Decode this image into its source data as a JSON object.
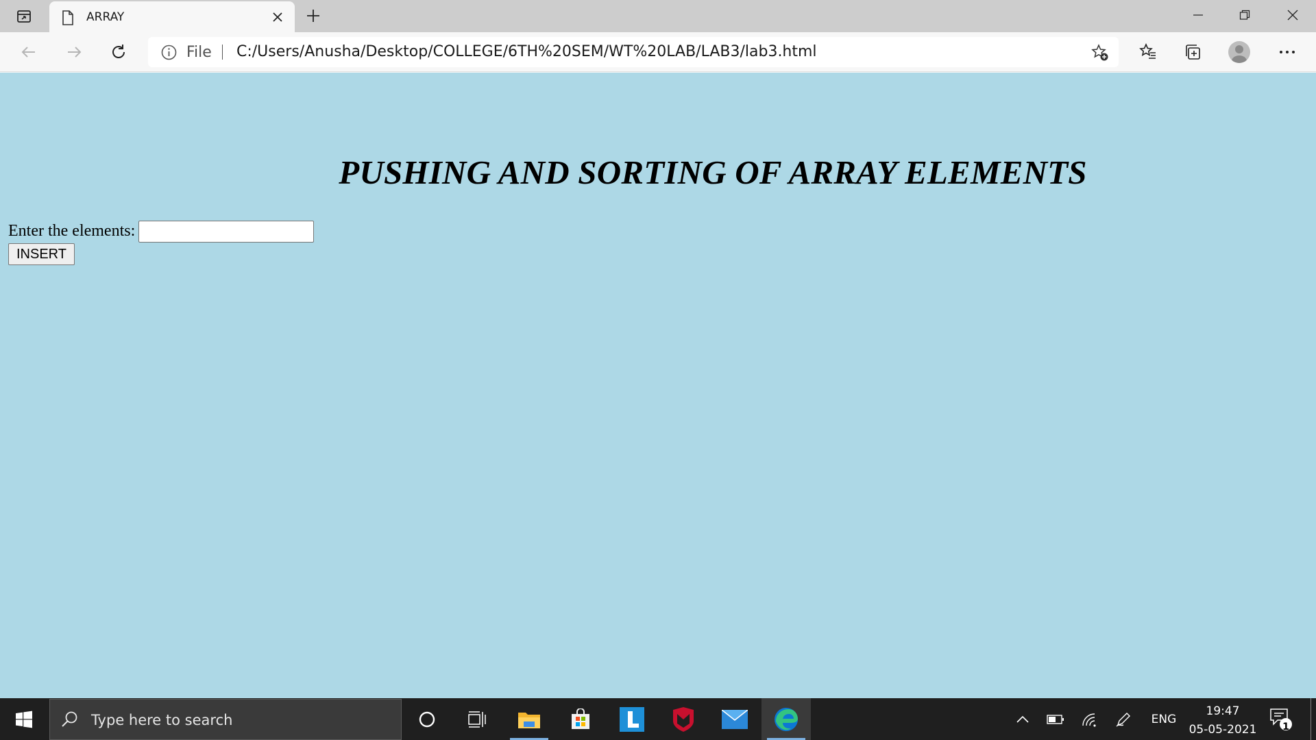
{
  "browser": {
    "tab": {
      "title": "ARRAY"
    },
    "address": {
      "scheme_label": "File",
      "url": "C:/Users/Anusha/Desktop/COLLEGE/6TH%20SEM/WT%20LAB/LAB3/lab3.html"
    }
  },
  "page": {
    "heading": "PUSHING AND SORTING OF ARRAY ELEMENTS",
    "form": {
      "label": "Enter the elements:",
      "input_value": "",
      "button_label": "INSERT"
    },
    "background_color": "#add8e6"
  },
  "taskbar": {
    "search_placeholder": "Type here to search",
    "language": "ENG",
    "time": "19:47",
    "date": "05-05-2021",
    "notification_count": "1",
    "pinned_apps": [
      "cortana-icon",
      "task-view-icon",
      "file-explorer-icon",
      "store-icon",
      "l-app-icon",
      "mcafee-icon",
      "mail-icon",
      "edge-icon"
    ]
  }
}
